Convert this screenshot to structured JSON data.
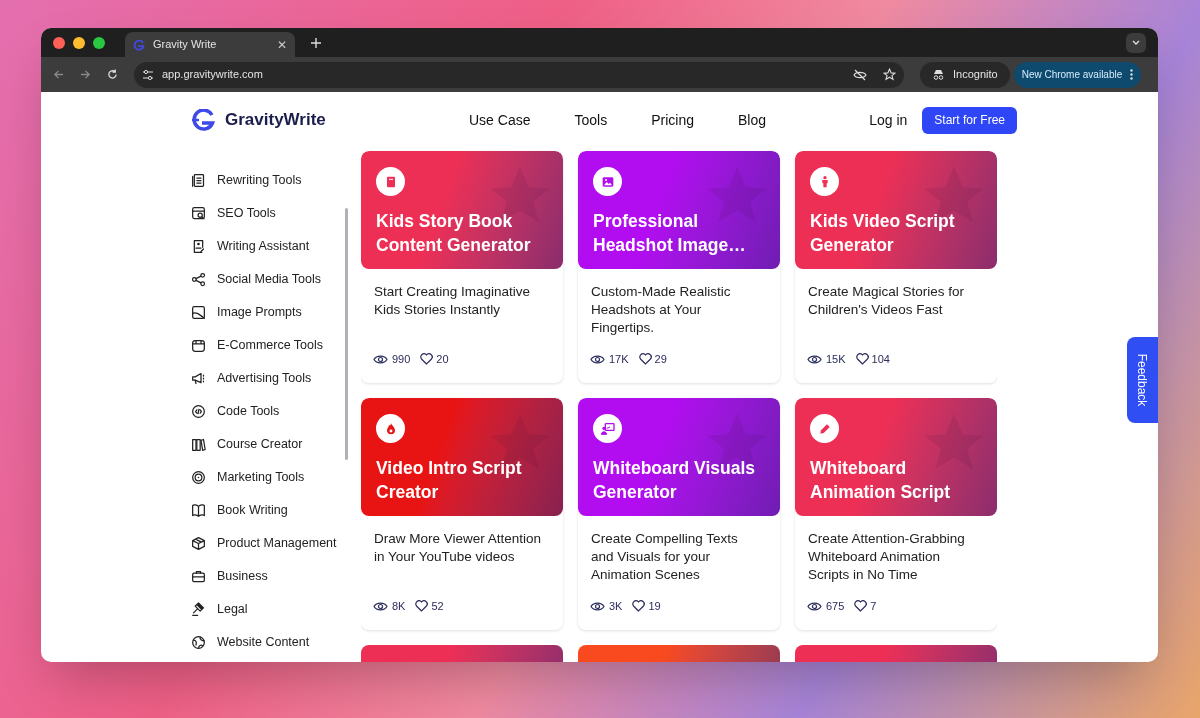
{
  "browser": {
    "tab_title": "Gravity Write",
    "tab_close": "✕",
    "url": "app.gravitywrite.com",
    "incognito": "Incognito",
    "update": "New Chrome available"
  },
  "header": {
    "brand": "GravityWrite",
    "nav": [
      "Use Case",
      "Tools",
      "Pricing",
      "Blog"
    ],
    "login": "Log in",
    "cta": "Start for Free"
  },
  "sidebar": {
    "items": [
      "Rewriting Tools",
      "SEO Tools",
      "Writing Assistant",
      "Social Media Tools",
      "Image Prompts",
      "E-Commerce Tools",
      "Advertising Tools",
      "Code Tools",
      "Course Creator",
      "Marketing Tools",
      "Book Writing",
      "Product Management",
      "Business",
      "Legal",
      "Website Content"
    ]
  },
  "cards": [
    {
      "kind": "full",
      "color": "#ee2f55",
      "title": "Kids Story Book Content Generator",
      "description": "Start Creating Imaginative Kids Stories Instantly",
      "views": "990",
      "likes": "20"
    },
    {
      "kind": "full",
      "color": "#b20cf0",
      "title": "Professional Headshot Image…",
      "description": "Custom-Made Realistic Headshots at Your Fingertips.",
      "views": "17K",
      "likes": "29"
    },
    {
      "kind": "full",
      "color": "#ee2f55",
      "title": "Kids Video Script Generator",
      "description": "Create Magical Stories for Children's Videos Fast",
      "views": "15K",
      "likes": "104"
    },
    {
      "kind": "full",
      "color": "#e81414",
      "title": "Video Intro Script Creator",
      "description": "Draw More Viewer Attention in Your YouTube videos",
      "views": "8K",
      "likes": "52"
    },
    {
      "kind": "full",
      "color": "#b20cf0",
      "title": "Whiteboard Visuals Generator",
      "description": "Create Compelling Texts and Visuals for your Animation Scenes",
      "views": "3K",
      "likes": "19"
    },
    {
      "kind": "full",
      "color": "#ee2f55",
      "title": "Whiteboard Animation Script",
      "description": "Create Attention-Grabbing Whiteboard Animation Scripts in No Time",
      "views": "675",
      "likes": "7"
    },
    {
      "kind": "partial",
      "color": "#ee2f55"
    },
    {
      "kind": "partial",
      "color": "#f84a1e"
    },
    {
      "kind": "partial",
      "color": "#ee2f55"
    }
  ],
  "feedback": "Feedback"
}
